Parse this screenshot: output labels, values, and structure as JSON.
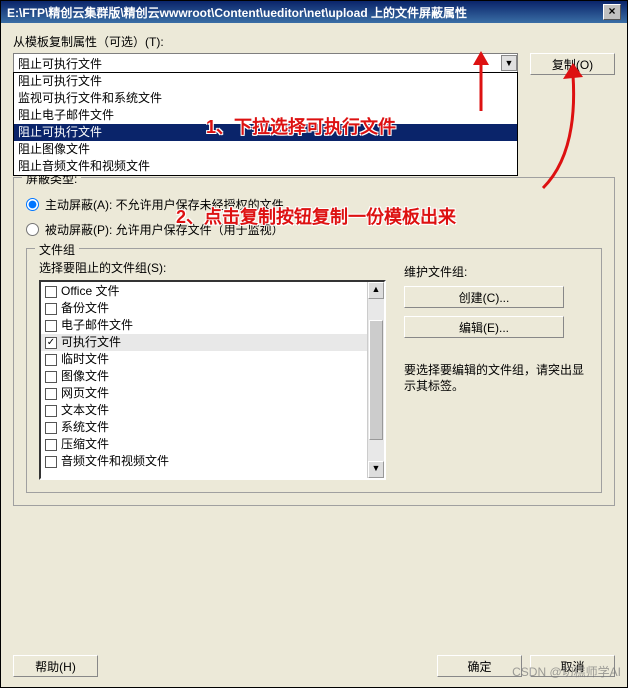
{
  "title": "E:\\FTP\\精创云集群版\\精创云wwwroot\\Content\\ueditor\\net\\upload 上的文件屏蔽属性",
  "template": {
    "label": "从模板复制属性（可选）(T):",
    "selected": "阻止可执行文件",
    "options": [
      "阻止可执行文件",
      "监视可执行文件和系统文件",
      "阻止电子邮件文件",
      "阻止可执行文件",
      "阻止图像文件",
      "阻止音频文件和视频文件"
    ],
    "selected_index": 3
  },
  "copy_btn": "复制(O)",
  "ghost_path": "E:\\FTP\\精创云集群版\\精创云wwwroot\\Content\\ueditor\\net\\...",
  "screen_type": {
    "label": "屏蔽类型:",
    "active": {
      "label": "主动屏蔽(A): 不允许用户保存未经授权的文件"
    },
    "passive": {
      "label": "被动屏蔽(P): 允许用户保存文件（用于监视）"
    },
    "value": "active"
  },
  "filegroup": {
    "legend": "文件组",
    "select_label": "选择要阻止的文件组(S):",
    "items": [
      {
        "label": "Office 文件",
        "checked": false
      },
      {
        "label": "备份文件",
        "checked": false
      },
      {
        "label": "电子邮件文件",
        "checked": false
      },
      {
        "label": "可执行文件",
        "checked": true
      },
      {
        "label": "临时文件",
        "checked": false
      },
      {
        "label": "图像文件",
        "checked": false
      },
      {
        "label": "网页文件",
        "checked": false
      },
      {
        "label": "文本文件",
        "checked": false
      },
      {
        "label": "系统文件",
        "checked": false
      },
      {
        "label": "压缩文件",
        "checked": false
      },
      {
        "label": "音频文件和视频文件",
        "checked": false
      }
    ],
    "maint_label": "维护文件组:",
    "create_btn": "创建(C)...",
    "edit_btn": "编辑(E)...",
    "maint_note": "要选择要编辑的文件组，请突出显示其标签。"
  },
  "footer": {
    "help": "帮助(H)",
    "ok": "确定",
    "cancel": "取消"
  },
  "annotations": {
    "a1": "1、下拉选择可执行文件",
    "a2": "2、点击复制按钮复制一份模板出来"
  },
  "watermark": "CSDN @切糕师学AI"
}
